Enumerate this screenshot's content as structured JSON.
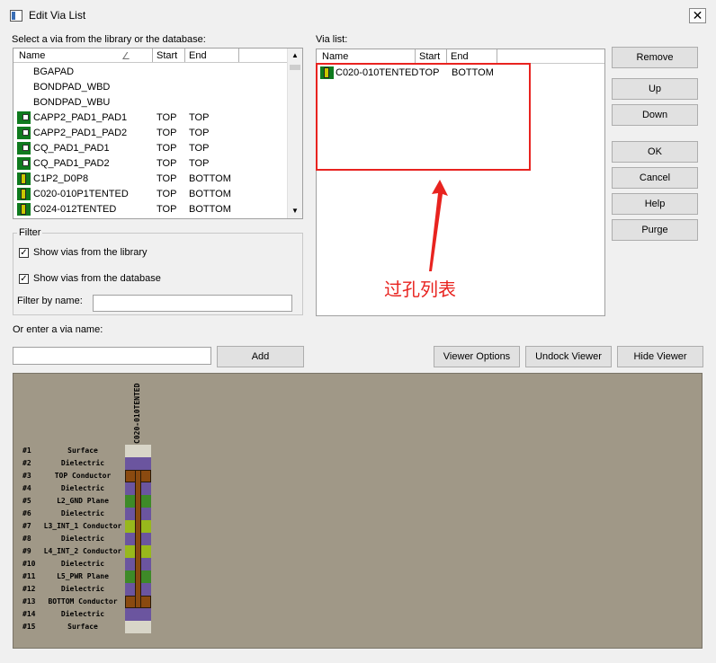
{
  "window": {
    "title": "Edit Via List",
    "close_glyph": "✕"
  },
  "library": {
    "label": "Select a via from the library or the database:",
    "columns": [
      "Name",
      "Start",
      "End"
    ],
    "sort_glyph": "∠",
    "rows": [
      {
        "icon": "none",
        "name": "BGAPAD",
        "start": "",
        "end": ""
      },
      {
        "icon": "none",
        "name": "BONDPAD_WBD",
        "start": "",
        "end": ""
      },
      {
        "icon": "none",
        "name": "BONDPAD_WBU",
        "start": "",
        "end": ""
      },
      {
        "icon": "pad-icon",
        "name": "CAPP2_PAD1_PAD1",
        "start": "TOP",
        "end": "TOP"
      },
      {
        "icon": "pad-icon",
        "name": "CAPP2_PAD1_PAD2",
        "start": "TOP",
        "end": "TOP"
      },
      {
        "icon": "pad-icon",
        "name": "CQ_PAD1_PAD1",
        "start": "TOP",
        "end": "TOP"
      },
      {
        "icon": "pad-icon",
        "name": "CQ_PAD1_PAD2",
        "start": "TOP",
        "end": "TOP"
      },
      {
        "icon": "via-icon",
        "name": "C1P2_D0P8",
        "start": "TOP",
        "end": "BOTTOM"
      },
      {
        "icon": "via-icon",
        "name": "C020-010P1TENTED",
        "start": "TOP",
        "end": "BOTTOM"
      },
      {
        "icon": "via-icon",
        "name": "C024-012TENTED",
        "start": "TOP",
        "end": "BOTTOM"
      }
    ]
  },
  "vialist": {
    "label": "Via list:",
    "columns": [
      "Name",
      "Start",
      "End"
    ],
    "rows": [
      {
        "icon": "via-icon",
        "name": "C020-010TENTED",
        "start": "TOP",
        "end": "BOTTOM"
      }
    ]
  },
  "buttons": {
    "remove": "Remove",
    "up": "Up",
    "down": "Down",
    "ok": "OK",
    "cancel": "Cancel",
    "help": "Help",
    "purge": "Purge",
    "add": "Add",
    "viewer_options": "Viewer Options",
    "undock_viewer": "Undock Viewer",
    "hide_viewer": "Hide Viewer"
  },
  "filter": {
    "title": "Filter",
    "show_library": "Show vias from the library",
    "show_database": "Show vias from the database",
    "show_library_checked": true,
    "show_database_checked": true,
    "by_name_label": "Filter by name:",
    "by_name_value": ""
  },
  "enter": {
    "label": "Or enter a via name:",
    "value": ""
  },
  "viewer": {
    "via_name": "C020-010TENTED",
    "layers": [
      {
        "num": "#1",
        "name": "Surface",
        "kind": "surface"
      },
      {
        "num": "#2",
        "name": "Dielectric",
        "kind": "dielectric"
      },
      {
        "num": "#3",
        "name": "TOP Conductor",
        "kind": "pad"
      },
      {
        "num": "#4",
        "name": "Dielectric",
        "kind": "dielectric"
      },
      {
        "num": "#5",
        "name": "L2_GND Plane",
        "kind": "plane"
      },
      {
        "num": "#6",
        "name": "Dielectric",
        "kind": "dielectric"
      },
      {
        "num": "#7",
        "name": "L3_INT_1 Conductor",
        "kind": "conductor"
      },
      {
        "num": "#8",
        "name": "Dielectric",
        "kind": "dielectric"
      },
      {
        "num": "#9",
        "name": "L4_INT_2 Conductor",
        "kind": "conductor"
      },
      {
        "num": "#10",
        "name": "Dielectric",
        "kind": "dielectric"
      },
      {
        "num": "#11",
        "name": "L5_PWR Plane",
        "kind": "plane"
      },
      {
        "num": "#12",
        "name": "Dielectric",
        "kind": "dielectric"
      },
      {
        "num": "#13",
        "name": "BOTTOM Conductor",
        "kind": "pad"
      },
      {
        "num": "#14",
        "name": "Dielectric",
        "kind": "dielectric"
      },
      {
        "num": "#15",
        "name": "Surface",
        "kind": "surface"
      }
    ],
    "colors": {
      "surface": "#d8d5c8",
      "dielectric": "#6b559f",
      "plane": "#3e8a28",
      "conductor": "#98b81c",
      "pad": "#8a4a10",
      "barrel": "#8a4a10"
    }
  },
  "annotation": {
    "text": "过孔列表",
    "color": "#e8231f"
  }
}
